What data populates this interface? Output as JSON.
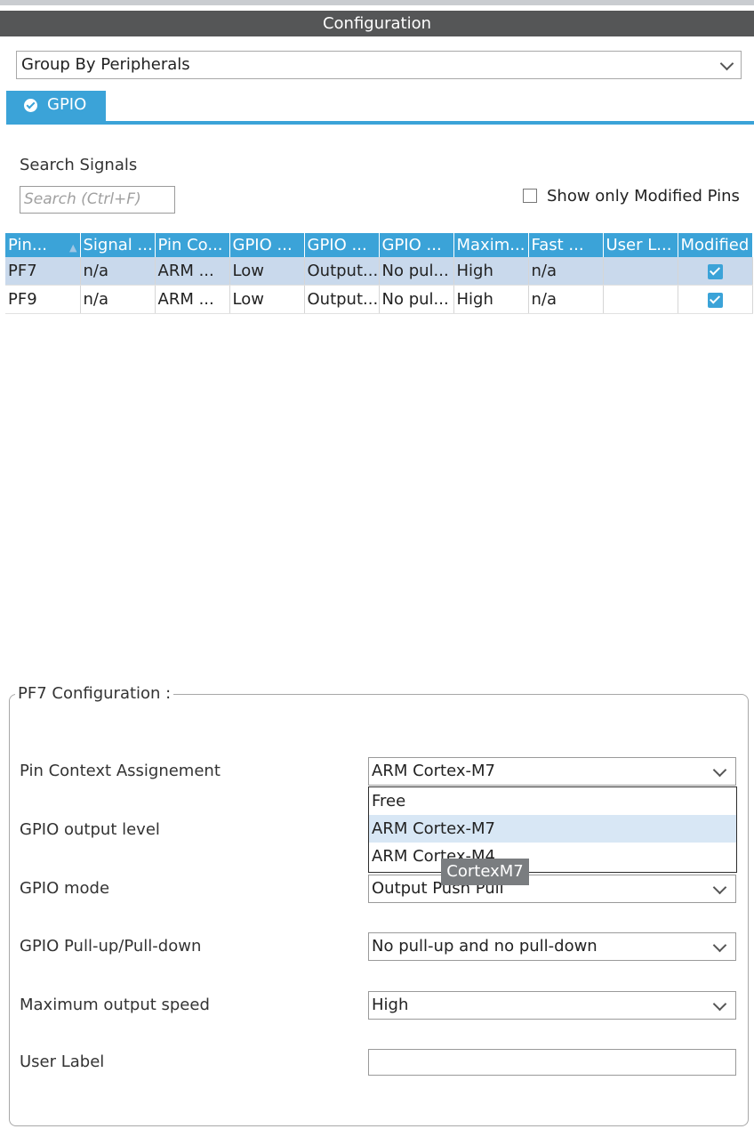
{
  "window": {
    "title": "Configuration"
  },
  "group_select": {
    "value": "Group By Peripherals"
  },
  "tabs": [
    {
      "label": "GPIO"
    }
  ],
  "search": {
    "label": "Search Signals",
    "placeholder": "Search (Ctrl+F)"
  },
  "modified_filter": {
    "label": "Show only Modified Pins",
    "checked": false
  },
  "table": {
    "columns": [
      "Pin...",
      "Signal ...",
      "Pin Co...",
      "GPIO ...",
      "GPIO ...",
      "GPIO ...",
      "Maxim...",
      "Fast ...",
      "User L...",
      "Modified"
    ],
    "rows": [
      {
        "pin": "PF7",
        "signal": "n/a",
        "context": "ARM ...",
        "level": "Low",
        "mode": "Output...",
        "pull": "No pul...",
        "speed": "High",
        "fast": "n/a",
        "user_label": "",
        "modified": true
      },
      {
        "pin": "PF9",
        "signal": "n/a",
        "context": "ARM ...",
        "level": "Low",
        "mode": "Output...",
        "pull": "No pul...",
        "speed": "High",
        "fast": "n/a",
        "user_label": "",
        "modified": true
      }
    ]
  },
  "config": {
    "legend": "PF7 Configuration :",
    "fields": {
      "context": {
        "label": "Pin Context Assignement",
        "value": "ARM Cortex-M7"
      },
      "output_level": {
        "label": "GPIO output level"
      },
      "mode": {
        "label": "GPIO mode",
        "value": "Output Push Pull"
      },
      "pull": {
        "label": "GPIO Pull-up/Pull-down",
        "value": "No pull-up and no pull-down"
      },
      "speed": {
        "label": "Maximum output speed",
        "value": "High"
      },
      "user_label": {
        "label": "User Label",
        "value": ""
      }
    },
    "context_options": [
      "Free",
      "ARM Cortex-M7",
      "ARM Cortex-M4"
    ],
    "highlighted_option": "ARM Cortex-M7",
    "tooltip": "CortexM7"
  },
  "colors": {
    "accent": "#3ba3d8",
    "title_bar": "#555657",
    "selected_row": "#c9d9ec"
  }
}
